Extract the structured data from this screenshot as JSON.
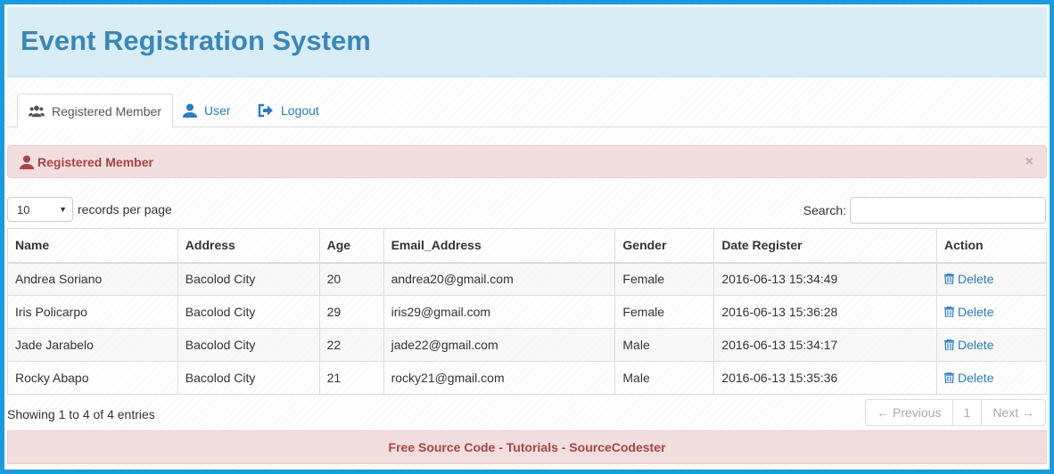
{
  "header": {
    "title": "Event Registration System"
  },
  "tabs": [
    {
      "label": "Registered Member",
      "icon": "users-icon",
      "active": true
    },
    {
      "label": "User",
      "icon": "user-icon",
      "active": false
    },
    {
      "label": "Logout",
      "icon": "logout-icon",
      "active": false
    }
  ],
  "alert": {
    "title": "Registered Member",
    "close": "×"
  },
  "length": {
    "value": "10",
    "suffix": "records per page"
  },
  "search": {
    "label": "Search:"
  },
  "table": {
    "columns": [
      "Name",
      "Address",
      "Age",
      "Email_Address",
      "Gender",
      "Date Register",
      "Action"
    ],
    "rows": [
      [
        "Andrea Soriano",
        "Bacolod City",
        "20",
        "andrea20@gmail.com",
        "Female",
        "2016-06-13 15:34:49",
        "Delete"
      ],
      [
        "Iris Policarpo",
        "Bacolod City",
        "29",
        "iris29@gmail.com",
        "Female",
        "2016-06-13 15:36:28",
        "Delete"
      ],
      [
        "Jade Jarabelo",
        "Bacolod City",
        "22",
        "jade22@gmail.com",
        "Male",
        "2016-06-13 15:34:17",
        "Delete"
      ],
      [
        "Rocky Abapo",
        "Bacolod City",
        "21",
        "rocky21@gmail.com",
        "Male",
        "2016-06-13 15:35:36",
        "Delete"
      ]
    ]
  },
  "info": "Showing 1 to 4 of 4 entries",
  "pagination": {
    "previous": "← Previous",
    "page": "1",
    "next": "Next →"
  },
  "footer": "Free Source Code - Tutorials - SourceCodester",
  "colors": {
    "header_bg": "#d9edf7",
    "title": "#3a87b8",
    "link": "#2a7bc0",
    "danger": "#a94442",
    "danger_bg": "#f2dede",
    "frame": "#1a9be0"
  }
}
